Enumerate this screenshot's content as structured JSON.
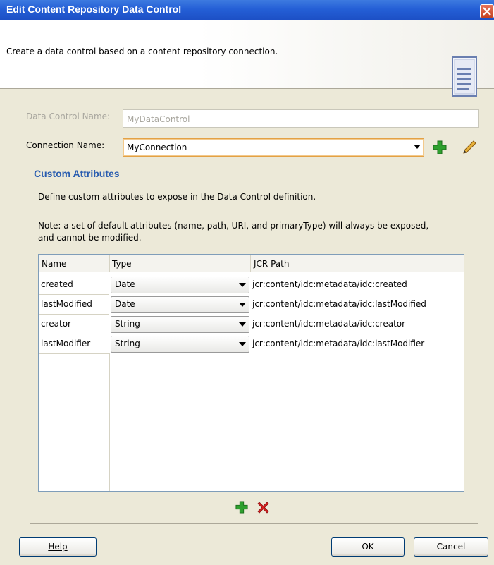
{
  "dialog": {
    "title": "Edit Content Repository Data Control",
    "description": "Create a data control based on a content repository connection."
  },
  "form": {
    "data_control_name_label": "Data Control Name:",
    "data_control_name_value": "MyDataControl",
    "connection_name_label": "Connection Name:",
    "connection_name_value": "MyConnection"
  },
  "custom_attributes": {
    "title": "Custom Attributes",
    "description": "Define custom attributes to expose in the Data Control definition.",
    "note_line1": "Note: a set of default attributes (name, path, URI, and primaryType) will always be exposed,",
    "note_line2": "and cannot be modified.",
    "columns": [
      "Name",
      "Type",
      "JCR Path"
    ],
    "rows": [
      {
        "name": "created",
        "type": "Date",
        "path": "jcr:content/idc:metadata/idc:created"
      },
      {
        "name": "lastModified",
        "type": "Date",
        "path": "jcr:content/idc:metadata/idc:lastModified"
      },
      {
        "name": "creator",
        "type": "String",
        "path": "jcr:content/idc:metadata/idc:creator"
      },
      {
        "name": "lastModifier",
        "type": "String",
        "path": "jcr:content/idc:metadata/idc:lastModifier"
      }
    ]
  },
  "buttons": {
    "help": "Help",
    "ok": "OK",
    "cancel": "Cancel"
  },
  "colors": {
    "title_bar": "#245fd6",
    "group_title": "#2a5db0",
    "add_icon": "#2ea02e",
    "remove_icon": "#d62020"
  },
  "icons": {
    "close": "close-icon",
    "header": "document-icon",
    "add_connection": "plus-icon",
    "edit_connection": "pencil-icon",
    "add_row": "plus-icon",
    "remove_row": "x-icon"
  }
}
